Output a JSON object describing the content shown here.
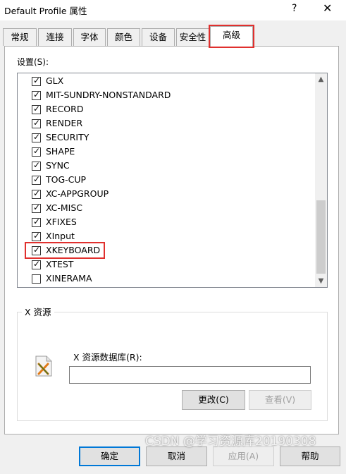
{
  "window": {
    "title": "Default Profile 属性",
    "help_glyph": "?",
    "close_glyph": "✕"
  },
  "tabs": [
    {
      "label": "常规",
      "active": false
    },
    {
      "label": "连接",
      "active": false
    },
    {
      "label": "字体",
      "active": false
    },
    {
      "label": "颜色",
      "active": false
    },
    {
      "label": "设备",
      "active": false
    },
    {
      "label": "安全性",
      "active": false
    },
    {
      "label": "高级",
      "active": true
    }
  ],
  "settings": {
    "label": "设置(S):",
    "items": [
      {
        "label": "GLX",
        "checked": true
      },
      {
        "label": "MIT-SUNDRY-NONSTANDARD",
        "checked": true
      },
      {
        "label": "RECORD",
        "checked": true
      },
      {
        "label": "RENDER",
        "checked": true
      },
      {
        "label": "SECURITY",
        "checked": true
      },
      {
        "label": "SHAPE",
        "checked": true
      },
      {
        "label": "SYNC",
        "checked": true
      },
      {
        "label": "TOG-CUP",
        "checked": true
      },
      {
        "label": "XC-APPGROUP",
        "checked": true
      },
      {
        "label": "XC-MISC",
        "checked": true
      },
      {
        "label": "XFIXES",
        "checked": true
      },
      {
        "label": "XInput",
        "checked": true
      },
      {
        "label": "XKEYBOARD",
        "checked": true,
        "highlighted": true
      },
      {
        "label": "XTEST",
        "checked": true
      },
      {
        "label": "XINERAMA",
        "checked": false
      }
    ],
    "scroll_up_glyph": "▲",
    "scroll_down_glyph": "▼"
  },
  "xresources": {
    "group_title": "X 资源",
    "db_label": "X 资源数据库(R):",
    "db_value": "",
    "change_button": "更改(C)",
    "view_button": "查看(V)"
  },
  "footer": {
    "ok": "确定",
    "cancel": "取消",
    "apply": "应用(A)",
    "help": "帮助"
  },
  "watermark": "CSDN @学习资源库20190308",
  "colors": {
    "highlight": "#e0302e",
    "dialog_bg": "#f0f0f0"
  }
}
